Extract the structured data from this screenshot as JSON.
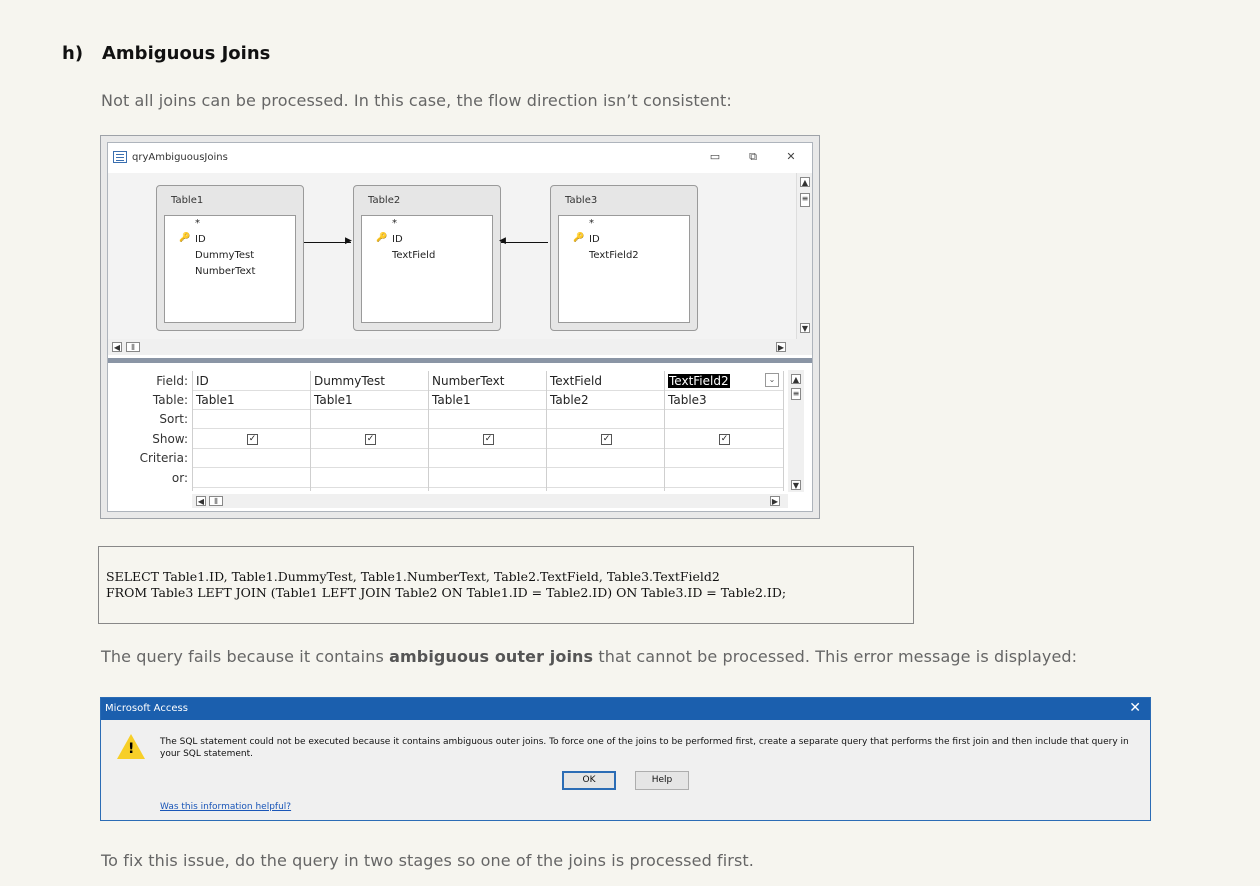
{
  "heading": {
    "number": "h)",
    "title": "Ambiguous Joins"
  },
  "intro": "Not all joins can be processed. In this case, the flow direction isn’t consistent:",
  "query_window": {
    "title": "qryAmbiguousJoins",
    "tables": [
      {
        "name": "Table1",
        "star": "*",
        "key_field": "ID",
        "fields": [
          "DummyTest",
          "NumberText"
        ]
      },
      {
        "name": "Table2",
        "star": "*",
        "key_field": "ID",
        "fields": [
          "TextField"
        ]
      },
      {
        "name": "Table3",
        "star": "*",
        "key_field": "ID",
        "fields": [
          "TextField2"
        ]
      }
    ],
    "row_labels": [
      "Field:",
      "Table:",
      "Sort:",
      "Show:",
      "Criteria:",
      "or:"
    ],
    "columns": [
      {
        "field": "ID",
        "table": "Table1",
        "show": true
      },
      {
        "field": "DummyTest",
        "table": "Table1",
        "show": true
      },
      {
        "field": "NumberText",
        "table": "Table1",
        "show": true
      },
      {
        "field": "TextField",
        "table": "Table2",
        "show": true
      },
      {
        "field": "TextField2",
        "table": "Table3",
        "show": true
      }
    ]
  },
  "sql": {
    "line1": "SELECT Table1.ID, Table1.DummyTest, Table1.NumberText, Table2.TextField, Table3.TextField2",
    "line2": "FROM Table3 LEFT JOIN (Table1 LEFT JOIN Table2 ON Table1.ID = Table2.ID) ON Table3.ID = Table2.ID;"
  },
  "failure_text": {
    "before": "The query fails because it contains ",
    "bold": "ambiguous outer joins",
    "after": " that cannot be processed. This error message is displayed:"
  },
  "dialog": {
    "title": "Microsoft Access",
    "message": "The SQL statement could not be executed because it contains ambiguous outer joins. To force one of the joins to be performed first, create a separate query that performs the first join and then include that query in your SQL statement.",
    "ok_label": "OK",
    "help_label": "Help",
    "link": "Was this information helpful?"
  },
  "fix_text": "To fix this issue, do the query in two stages so one of the joins is processed first."
}
